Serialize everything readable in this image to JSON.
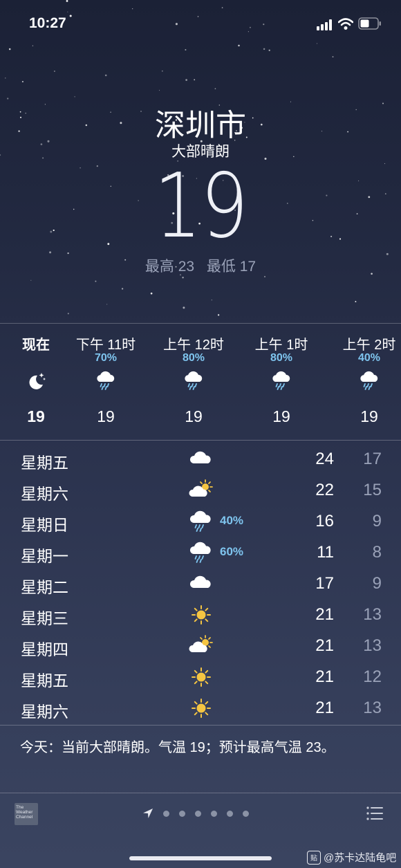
{
  "status_bar": {
    "time": "10:27"
  },
  "current": {
    "city": "深圳市",
    "condition": "大部晴朗",
    "temperature": "19",
    "high": "最高 23",
    "low": "最低 17"
  },
  "hourly": [
    {
      "label": "现在",
      "pct": "",
      "icon": "moon-stars-icon",
      "temp": "19"
    },
    {
      "label": "下午 11时",
      "pct": "70%",
      "icon": "rain-cloud-icon",
      "temp": "19"
    },
    {
      "label": "上午 12时",
      "pct": "80%",
      "icon": "rain-cloud-icon",
      "temp": "19"
    },
    {
      "label": "上午 1时",
      "pct": "80%",
      "icon": "rain-cloud-icon",
      "temp": "19"
    },
    {
      "label": "上午 2时",
      "pct": "40%",
      "icon": "rain-cloud-icon",
      "temp": "19"
    }
  ],
  "daily": [
    {
      "day": "星期五",
      "icon": "cloud-icon",
      "pct": "",
      "hi": "24",
      "lo": "17"
    },
    {
      "day": "星期六",
      "icon": "partly-sunny-icon",
      "pct": "",
      "hi": "22",
      "lo": "15"
    },
    {
      "day": "星期日",
      "icon": "rain-cloud-icon",
      "pct": "40%",
      "hi": "16",
      "lo": "9"
    },
    {
      "day": "星期一",
      "icon": "rain-cloud-icon",
      "pct": "60%",
      "hi": "11",
      "lo": "8"
    },
    {
      "day": "星期二",
      "icon": "cloud-icon",
      "pct": "",
      "hi": "17",
      "lo": "9"
    },
    {
      "day": "星期三",
      "icon": "sun-icon",
      "pct": "",
      "hi": "21",
      "lo": "13"
    },
    {
      "day": "星期四",
      "icon": "partly-sunny-icon",
      "pct": "",
      "hi": "21",
      "lo": "13"
    },
    {
      "day": "星期五",
      "icon": "sun-icon",
      "pct": "",
      "hi": "21",
      "lo": "12"
    },
    {
      "day": "星期六",
      "icon": "sun-icon",
      "pct": "",
      "hi": "21",
      "lo": "13"
    }
  ],
  "summary": "今天：当前大部晴朗。气温 19；预计最高气温 23。",
  "footer": {
    "logo_text": "The Weather Channel",
    "watermark_badge": "贴",
    "watermark": "@苏卡达陆龟吧"
  },
  "colors": {
    "precip": "#7fc5ef",
    "low_temp": "#9aa2b8",
    "sun": "#f5c542"
  }
}
